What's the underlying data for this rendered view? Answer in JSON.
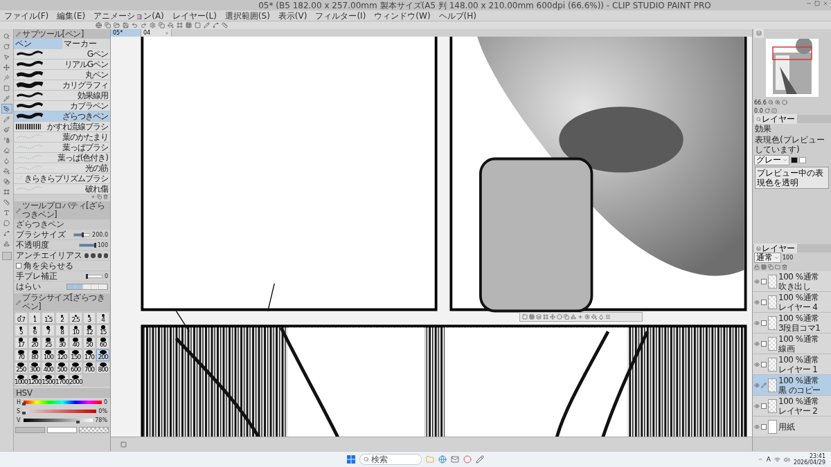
{
  "window": {
    "title": "05* (B5 182.00 x 257.00mm 製本サイズ(A5 判 148.00 x 210.00mm 600dpi (66.6%)) - CLIP STUDIO PAINT PRO"
  },
  "menu": [
    "ファイル(F)",
    "編集(E)",
    "アニメーション(A)",
    "レイヤー(L)",
    "選択範囲(S)",
    "表示(V)",
    "フィルター(I)",
    "ウィンドウ(W)",
    "ヘルプ(H)"
  ],
  "document_tabs": [
    {
      "label": "05*",
      "selected": true
    },
    {
      "label": "04",
      "selected": false
    }
  ],
  "tools": [
    {
      "kind": "zoom",
      "selected": false
    },
    {
      "kind": "rotate",
      "selected": false
    },
    {
      "kind": "operation",
      "selected": false
    },
    {
      "kind": "move",
      "selected": false
    },
    {
      "kind": "wand",
      "selected": false
    },
    {
      "kind": "marquee",
      "selected": false
    },
    {
      "kind": "eyedropper",
      "selected": false
    },
    {
      "kind": "pen",
      "selected": true
    },
    {
      "kind": "pencil",
      "selected": false
    },
    {
      "kind": "brush",
      "selected": false
    },
    {
      "kind": "airbrush",
      "selected": false
    },
    {
      "kind": "eraser",
      "selected": false
    },
    {
      "kind": "blend",
      "selected": false
    },
    {
      "kind": "fill",
      "selected": false
    },
    {
      "kind": "gradient",
      "selected": false
    },
    {
      "kind": "frame",
      "selected": false
    },
    {
      "kind": "ruler",
      "selected": false
    },
    {
      "kind": "text",
      "selected": false
    },
    {
      "kind": "balloon",
      "selected": false
    },
    {
      "kind": "line",
      "selected": false
    },
    {
      "kind": "figure",
      "selected": false
    }
  ],
  "sub_tool": {
    "title": "サブツール[ペン]",
    "groups": [
      {
        "label": "ペン",
        "selected": true
      },
      {
        "label": "マーカー",
        "selected": false
      }
    ],
    "brushes": [
      {
        "name": "Gペン",
        "selected": false
      },
      {
        "name": "リアルGペン",
        "selected": false
      },
      {
        "name": "丸ペン",
        "selected": false
      },
      {
        "name": "カリグラフィ",
        "selected": false
      },
      {
        "name": "効果線用",
        "selected": false
      },
      {
        "name": "カブラペン",
        "selected": false
      },
      {
        "name": "ざらつきペン",
        "selected": true
      },
      {
        "name": "かすれ流線ブラシ",
        "selected": false
      },
      {
        "name": "葉のかたまり",
        "selected": false
      },
      {
        "name": "葉っぱブラシ",
        "selected": false
      },
      {
        "name": "葉っぱ(色付き)",
        "selected": false
      },
      {
        "name": "光の筋",
        "selected": false
      },
      {
        "name": "きらきらプリズムブラシ",
        "selected": false
      },
      {
        "name": "破れ傷",
        "selected": false
      }
    ]
  },
  "tool_property": {
    "title": "ツールプロパティ[ざらつきペン]",
    "brush_name": "ざらつきペン",
    "rows": [
      {
        "kind": "slider",
        "label": "ブラシサイズ",
        "value": "200.0",
        "level": 0.55
      },
      {
        "kind": "slider",
        "label": "不透明度",
        "value": "100",
        "level": 1
      },
      {
        "kind": "antialias",
        "label": "アンチエイリアス"
      },
      {
        "kind": "checkbox",
        "label": "角を尖らせる",
        "checked": false
      },
      {
        "kind": "slider",
        "label": "手ブレ補正",
        "value": "0",
        "level": 0
      },
      {
        "kind": "segments",
        "label": "はらい",
        "level": 0.4
      }
    ]
  },
  "brush_size": {
    "title": "ブラシサイズ[ざらつきペン]",
    "sizes": [
      {
        "label": "0.7",
        "selected": false
      },
      {
        "label": "1",
        "selected": false
      },
      {
        "label": "1.5",
        "selected": false
      },
      {
        "label": "2",
        "selected": false
      },
      {
        "label": "2.5",
        "selected": false
      },
      {
        "label": "3",
        "selected": false
      },
      {
        "label": "4",
        "selected": false
      },
      {
        "label": "5",
        "selected": false
      },
      {
        "label": "6",
        "selected": false
      },
      {
        "label": "7",
        "selected": false
      },
      {
        "label": "8",
        "selected": false
      },
      {
        "label": "10",
        "selected": false
      },
      {
        "label": "12",
        "selected": false
      },
      {
        "label": "15",
        "selected": false
      },
      {
        "label": "17",
        "selected": false
      },
      {
        "label": "20",
        "selected": false
      },
      {
        "label": "25",
        "selected": false
      },
      {
        "label": "30",
        "selected": false
      },
      {
        "label": "40",
        "selected": false
      },
      {
        "label": "50",
        "selected": false
      },
      {
        "label": "60",
        "selected": false
      },
      {
        "label": "70",
        "selected": false
      },
      {
        "label": "80",
        "selected": false
      },
      {
        "label": "100",
        "selected": false
      },
      {
        "label": "120",
        "selected": false
      },
      {
        "label": "150",
        "selected": false
      },
      {
        "label": "170",
        "selected": false
      },
      {
        "label": "200",
        "selected": true
      },
      {
        "label": "250",
        "selected": false
      },
      {
        "label": "300",
        "selected": false
      },
      {
        "label": "400",
        "selected": false
      },
      {
        "label": "500",
        "selected": false
      },
      {
        "label": "600",
        "selected": false
      },
      {
        "label": "700",
        "selected": false
      },
      {
        "label": "800",
        "selected": false
      },
      {
        "label": "1000",
        "selected": false
      },
      {
        "label": "1200",
        "selected": false
      },
      {
        "label": "1500",
        "selected": false
      },
      {
        "label": "1700",
        "selected": false
      },
      {
        "label": "2000",
        "selected": false
      }
    ]
  },
  "color": {
    "mode": "HSV",
    "channels": [
      {
        "label": "H",
        "value": "0",
        "level": 0
      },
      {
        "label": "S",
        "value": "0%",
        "level": 0
      },
      {
        "label": "V",
        "value": "78%",
        "level": 0.78
      }
    ]
  },
  "navigator": {
    "zoom": "66.6",
    "rotation": "0.0"
  },
  "layer_property": {
    "tab": "レイヤー",
    "effect_label": "効果",
    "expression_label": "表現色(プレビューしています)",
    "expression_value": "グレー",
    "transparent_button": "プレビュー中の表現色を透明"
  },
  "layers": {
    "tab": "レイヤー",
    "blend": "通常",
    "opacity": "100",
    "items": [
      {
        "mode": "100 %通常",
        "name": "吹き出し",
        "selected": false
      },
      {
        "mode": "100 %通常",
        "name": "レイヤー 4",
        "selected": false
      },
      {
        "mode": "100 %通常",
        "name": "3段目コマ1",
        "selected": false
      },
      {
        "mode": "100 %通常",
        "name": "線画",
        "selected": false
      },
      {
        "mode": "100 %通常",
        "name": "レイヤー 1",
        "selected": false
      },
      {
        "mode": "100 %通常",
        "name": "黒 のコピー",
        "selected": true
      },
      {
        "mode": "100 %通常",
        "name": "レイヤー 2",
        "selected": false
      },
      {
        "name": "用紙",
        "selected": false
      }
    ]
  },
  "taskbar": {
    "search": "検索",
    "ime": "A",
    "time": "23:41",
    "date": "2026/04/29"
  }
}
